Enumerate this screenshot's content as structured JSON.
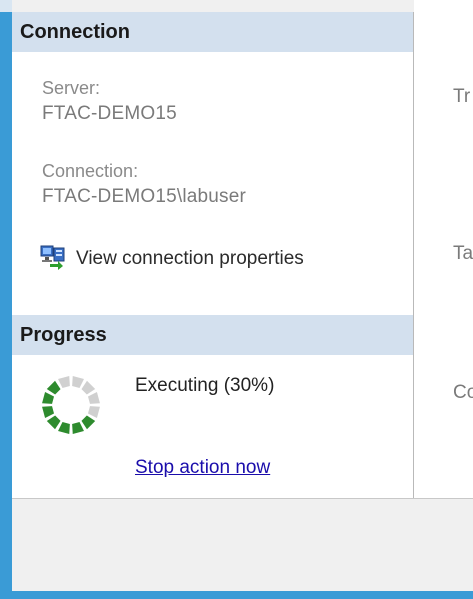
{
  "connection": {
    "header": "Connection",
    "server_label": "Server:",
    "server_value": "FTAC-DEMO15",
    "connection_label": "Connection:",
    "connection_value": "FTAC-DEMO15\\labuser",
    "view_properties_link": "View connection properties",
    "view_properties_icon": "connection-properties-icon"
  },
  "progress": {
    "header": "Progress",
    "status_text": "Executing (30%)",
    "percent": 30,
    "spinner_icon": "progress-spinner-icon",
    "stop_link": "Stop action now"
  },
  "right_pane": {
    "labels": [
      "Tr",
      "Ta",
      "Co"
    ]
  },
  "colors": {
    "window_border": "#3a9bd6",
    "section_header_bg": "#d3e0ee",
    "link": "#1a0dab",
    "spinner_active": "#2e8b2e",
    "spinner_inactive": "#d0d0d0"
  }
}
